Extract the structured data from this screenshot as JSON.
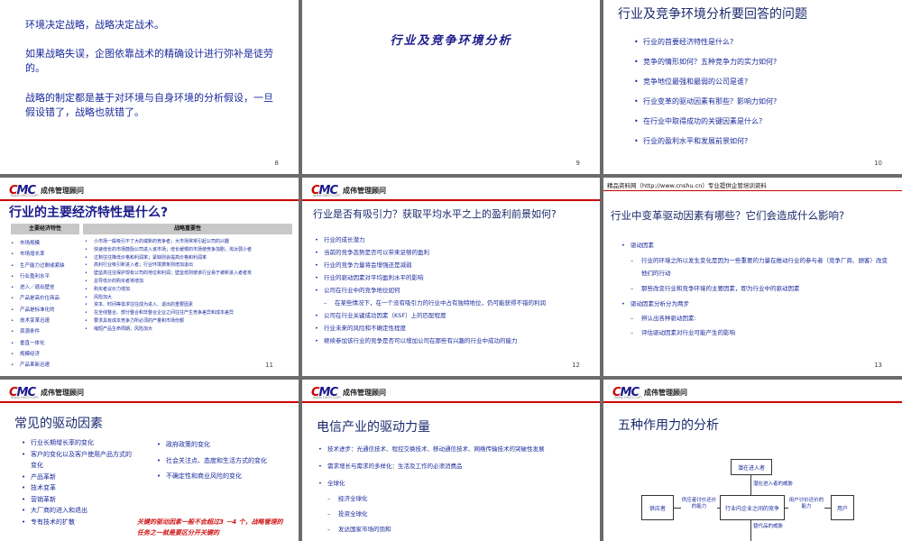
{
  "s8": {
    "lines": [
      "环境决定战略，战略决定战术。",
      "如果战略失误，企图依靠战术的精确设计进行弥补是徒劳的。",
      "战略的制定都是基于对环境与自身环境的分析假设，一旦假设错了，战略也就错了。"
    ],
    "page": "8"
  },
  "s9": {
    "title": "行业及竞争环境分析",
    "page": "9"
  },
  "s10": {
    "title": "行业及竞争环境分析要回答的问题",
    "items": [
      "行业的首要经济特性是什么?",
      "竞争的情形如何？五种竞争力的实力如何?",
      "竞争地位最强和最弱的公司是谁?",
      "行业变革的驱动因素有那些？影响力如何?",
      "在行业中取得成功的关键因素是什么?",
      "行业的盈利水平和发展前景如何?"
    ],
    "page": "10"
  },
  "logo": {
    "mark_c": "C",
    "mark_rest": "MC",
    "name": "成伟管理顾问",
    "url": "www.cwcn.com"
  },
  "s11": {
    "title": "行业的主要经济特性是什么?",
    "col1": "主要经济特性",
    "col2": "战略重要性",
    "left": [
      "市场规模",
      "市场增长率",
      "生产能力过剩或紧缺",
      "行业盈利水平",
      "进入／退出壁垒",
      "产品是高价位商品",
      "产品是标准化的",
      "技术变革迅速",
      "资源条件",
      "垂直一体化",
      "规模经济",
      "产品革新迅速"
    ],
    "right": [
      "小市场一般吸引不了大的或新的竞争者；大市场常常引起公司的兴趣",
      "快速增长的市场鼓励公司进入该市场；增长缓慢的市场使竞争加剧，淘汰弱小者",
      "过剩往往降低价格和利润率；紧缺则会提高价格和利润率",
      "高利行业吸引新进入者；行业环境萧条则增加退出",
      "壁垒高往往保护现有公司的地位和利润；壁垒低则使该行业易于被新进入者者攻",
      "总导低价的购买者将增加",
      "购买者议价力增加",
      "风险加大",
      "资本、时间等需求往往成为进入、退出的重要因素",
      "在全线整合、部分整合和非整合企业之间往往产生竞争差异和成本差异",
      "要求具有成本竞争力所必须的产量和市场份额",
      "缩短产品生命周期，风险加大"
    ],
    "page": "11"
  },
  "s12": {
    "title": "行业是否有吸引力？获取平均水平之上的盈利前景如何?",
    "items": [
      {
        "t": "行业的成长潜力",
        "d": false
      },
      {
        "t": "当前的竞争态势是否可以带来足够的盈利",
        "d": false
      },
      {
        "t": "行业的竞争力量将会增强还是减弱",
        "d": false
      },
      {
        "t": "行业的驱动因素对平均盈利水平的影响",
        "d": false
      },
      {
        "t": "公司在行业中的竞争地位如何",
        "d": false
      },
      {
        "t": "在某些情况下，在一个没有吸引力的行业中占有独特地位，仍可能获得不错的利润",
        "d": true
      },
      {
        "t": "公司在行业关键成功因素（KSF）上的匹配程度",
        "d": false
      },
      {
        "t": "行业未来的风险和不确定性程度",
        "d": false
      },
      {
        "t": "继续参加该行业的竞争是否可以增加公司在那些有兴趣的行业中成功的能力",
        "d": false
      }
    ],
    "page": "12"
  },
  "s13": {
    "header": "精品资料网（http://www.cnshu.cn）专业提供企管培训资料",
    "title": "行业中变革驱动因素有哪些？它们会造成什么影响?",
    "items": [
      {
        "t": "驱动因素",
        "d": false
      },
      {
        "t": "行业的环境之所以发生变化是因为一些重要的力量在推动行业的参与者（竞争厂商、顾客）改变他们的行动",
        "d": true
      },
      {
        "t": "那些改变行业和竞争环境的主要因素，即为行业中的驱动因素",
        "d": true
      },
      {
        "t": "驱动因素分析分为两步",
        "d": false
      },
      {
        "t": "辨认出各种驱动因素:",
        "d": true
      },
      {
        "t": "评估驱动因素对行业可能产生的影响",
        "d": true
      }
    ],
    "page": "13"
  },
  "s14": {
    "title": "常见的驱动因素",
    "left": [
      "行业长期增长率的变化",
      "客户的变化以及客户使用产品方式的变化",
      "产品革新",
      "技术变革",
      "营销革新",
      "大厂商的进入和退出",
      "专有技术的扩散"
    ],
    "right": [
      "政府政策的变化",
      "社会关注点、态度和生活方式的变化",
      "不确定性和商业风险的变化"
    ],
    "note": "关键的驱动因素一般不会超过3 －4 个，战略管理的任务之一就是要区分开关键的"
  },
  "s15": {
    "title": "电信产业的驱动力量",
    "items": [
      {
        "t": "技术进步：光通信技术、程控交换技术、移动通信技术、网络传输技术的突破性发展",
        "d": false
      },
      {
        "t": "需求增长与需求的多样化：生活及工作的必须消费品",
        "d": false
      },
      {
        "t": "全球化",
        "d": false
      },
      {
        "t": "经济全球化",
        "d": true
      },
      {
        "t": "投资全球化",
        "d": true
      },
      {
        "t": "发达国家市场的饱和",
        "d": true
      }
    ]
  },
  "s16": {
    "title": "五种作用力的分析",
    "new_entrant": "潜在进入者",
    "new_threat": "潜在进入者的威胁",
    "supplier": "供应者",
    "supplier_power": "供应者讨价还价的能力",
    "rivalry": "行业内企业之间的竞争",
    "buyer_power": "用户讨价还价的能力",
    "buyer": "用户",
    "substitute_threat": "替代品的威胁"
  }
}
